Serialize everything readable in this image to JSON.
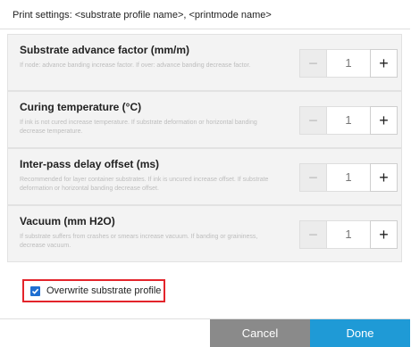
{
  "dialog": {
    "title": "Print settings: <substrate profile name>, <printmode name>",
    "settings": [
      {
        "label": "Substrate advance factor (mm/m)",
        "description": "If node: advance banding increase factor. If over: advance banding decrease factor.",
        "value": "1",
        "minus": "−",
        "plus": "+"
      },
      {
        "label": "Curing temperature (°C)",
        "description": "If ink is not cured increase temperature. If substrate deformation or horizontal banding decrease temperature.",
        "value": "1",
        "minus": "−",
        "plus": "+"
      },
      {
        "label": "Inter-pass delay offset (ms)",
        "description": "Recommended for layer container substrates. If ink is uncured increase offset. If substrate deformation or horizontal banding decrease offset.",
        "value": "1",
        "minus": "−",
        "plus": "+"
      },
      {
        "label": "Vacuum (mm H2O)",
        "description": "If substrate suffers from crashes or smears increase vacuum. If banding or graininess, decrease vacuum.",
        "value": "1",
        "minus": "−",
        "plus": "+"
      }
    ],
    "overwrite": {
      "label": "Overwrite substrate profile",
      "checked": true
    },
    "buttons": {
      "cancel": "Cancel",
      "done": "Done"
    },
    "colors": {
      "accent": "#1f9ad6",
      "cancel": "#8a8a8a",
      "highlight": "#e3242b"
    }
  }
}
